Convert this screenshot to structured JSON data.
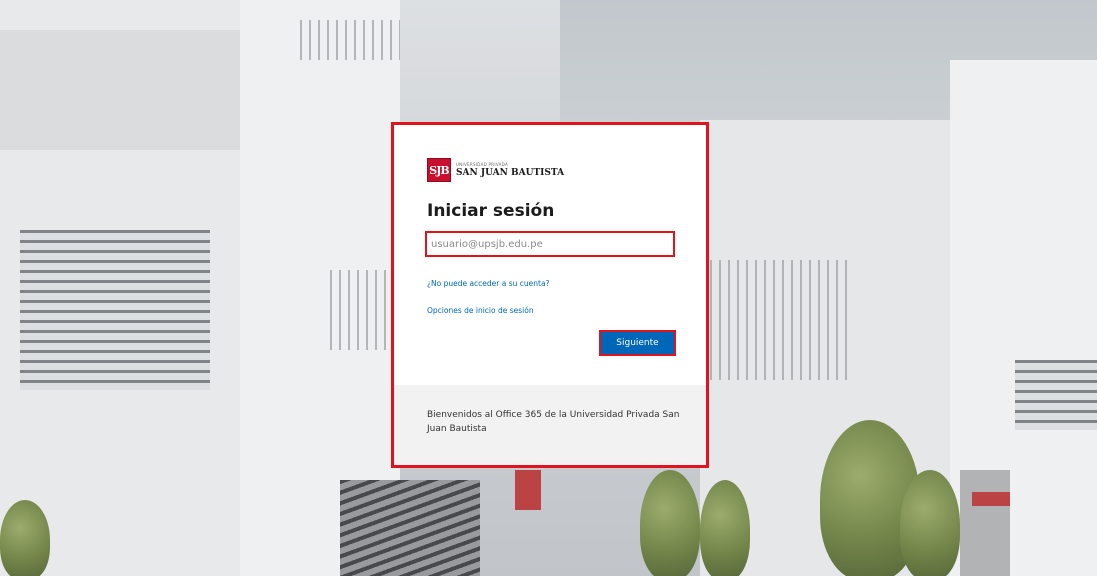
{
  "logo": {
    "mark": "SJB",
    "small": "UNIVERSIDAD PRIVADA",
    "name": "SAN JUAN BAUTISTA"
  },
  "login": {
    "title": "Iniciar sesión",
    "email_placeholder": "usuario@upsjb.edu.pe",
    "email_value": "",
    "forgot_link": "¿No puede acceder a su cuenta?",
    "options_link": "Opciones de inicio de sesión",
    "next_label": "Siguiente"
  },
  "footer": {
    "welcome": "Bienvenidos al Office 365 de la Universidad Privada San Juan Bautista"
  },
  "colors": {
    "highlight": "#e0141e",
    "primary": "#0067b8",
    "brand": "#c8102e"
  }
}
